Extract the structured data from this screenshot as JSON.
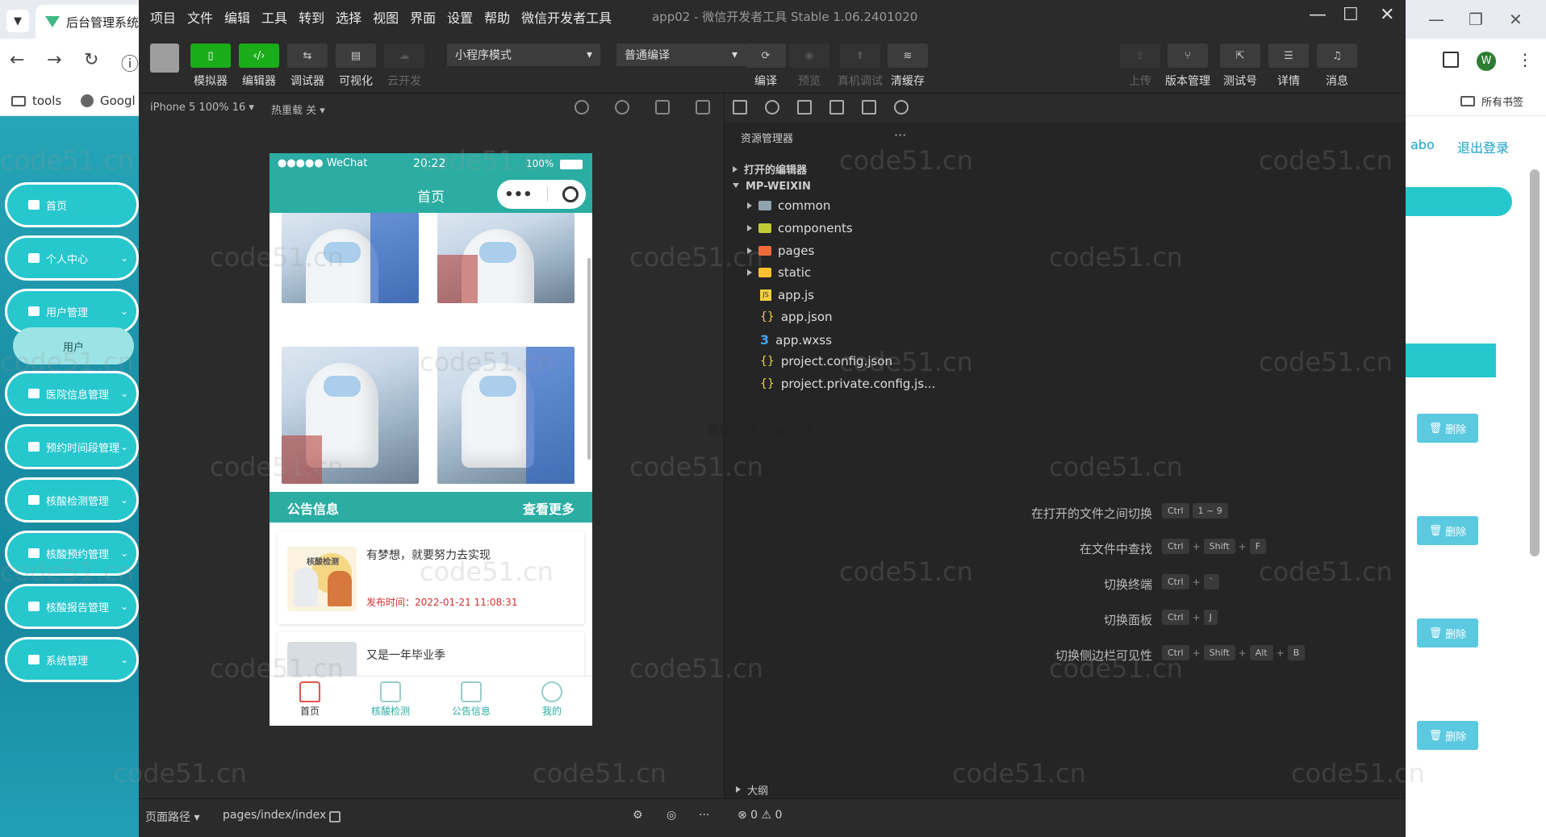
{
  "browser": {
    "tab_title": "后台管理系统",
    "bookmarks": [
      "tools",
      "Googl"
    ],
    "bookmark_right": "所有书签",
    "profile_initial": "W"
  },
  "admin": {
    "menu": [
      {
        "label": "首页"
      },
      {
        "label": "个人中心"
      },
      {
        "label": "用户管理"
      },
      {
        "label": "医院信息管理"
      },
      {
        "label": "预约时间段管理"
      },
      {
        "label": "核酸检测管理"
      },
      {
        "label": "核酸预约管理"
      },
      {
        "label": "核酸报告管理"
      },
      {
        "label": "系统管理"
      }
    ],
    "submenu_active": "用户",
    "right_links": [
      "abo",
      "退出登录"
    ],
    "delete_label": "删除"
  },
  "devtools": {
    "menu": [
      "项目",
      "文件",
      "编辑",
      "工具",
      "转到",
      "选择",
      "视图",
      "界面",
      "设置",
      "帮助",
      "微信开发者工具"
    ],
    "title": "app02 - 微信开发者工具 Stable 1.06.2401020",
    "toolbar": {
      "simulator": "模拟器",
      "editor": "编辑器",
      "debugger": "调试器",
      "visual": "可视化",
      "cloud": "云开发",
      "mode_select": "小程序模式",
      "compile_select": "普通编译",
      "compile": "编译",
      "preview": "预览",
      "remote_debug": "真机调试",
      "clear_cache": "清缓存",
      "upload": "上传",
      "version": "版本管理",
      "test_account": "测试号",
      "details": "详情",
      "messages": "消息"
    },
    "sim_device": "iPhone 5 100% 16 ▾",
    "hot_reload": "热重载 关 ▾",
    "explorer_title": "资源管理器",
    "open_editors": "打开的编辑器",
    "project_root": "MP-WEIXIN",
    "tree": [
      {
        "name": "common",
        "kind": "folder"
      },
      {
        "name": "components",
        "kind": "folder"
      },
      {
        "name": "pages",
        "kind": "folder"
      },
      {
        "name": "static",
        "kind": "folder"
      },
      {
        "name": "app.js",
        "kind": "js"
      },
      {
        "name": "app.json",
        "kind": "json"
      },
      {
        "name": "app.wxss",
        "kind": "css"
      },
      {
        "name": "project.config.json",
        "kind": "json"
      },
      {
        "name": "project.private.config.js...",
        "kind": "json"
      }
    ],
    "shortcuts": [
      {
        "label": "在打开的文件之间切换",
        "keys": [
          "Ctrl",
          "1 ~ 9"
        ]
      },
      {
        "label": "在文件中查找",
        "keys": [
          "Ctrl",
          "+",
          "Shift",
          "+",
          "F"
        ]
      },
      {
        "label": "切换终端",
        "keys": [
          "Ctrl",
          "+",
          "`"
        ]
      },
      {
        "label": "切换面板",
        "keys": [
          "Ctrl",
          "+",
          "J"
        ]
      },
      {
        "label": "切换侧边栏可见性",
        "keys": [
          "Ctrl",
          "+",
          "Shift",
          "+",
          "Alt",
          "+",
          "B"
        ]
      }
    ],
    "watermark_source": "源码久久-code99.top",
    "outline": "大纲",
    "status_path_label": "页面路径 ▾",
    "status_path": "pages/index/index",
    "problems": "⊗ 0 ⚠ 0"
  },
  "phone": {
    "carrier": "●●●●● WeChat",
    "time": "20:22",
    "battery": "100%",
    "page_title": "首页",
    "notice_title": "公告信息",
    "notice_more": "查看更多",
    "notices": [
      {
        "title": "有梦想，就要努力去实现",
        "date": "发布时间：2022-01-21 11:08:31",
        "thumb_tag": "核酸检测"
      },
      {
        "title": "又是一年毕业季",
        "date": "",
        "thumb_tag": ""
      }
    ],
    "tabs": [
      {
        "label": "首页"
      },
      {
        "label": "核酸检测"
      },
      {
        "label": "公告信息"
      },
      {
        "label": "我的"
      }
    ]
  },
  "watermark": "code51.cn"
}
